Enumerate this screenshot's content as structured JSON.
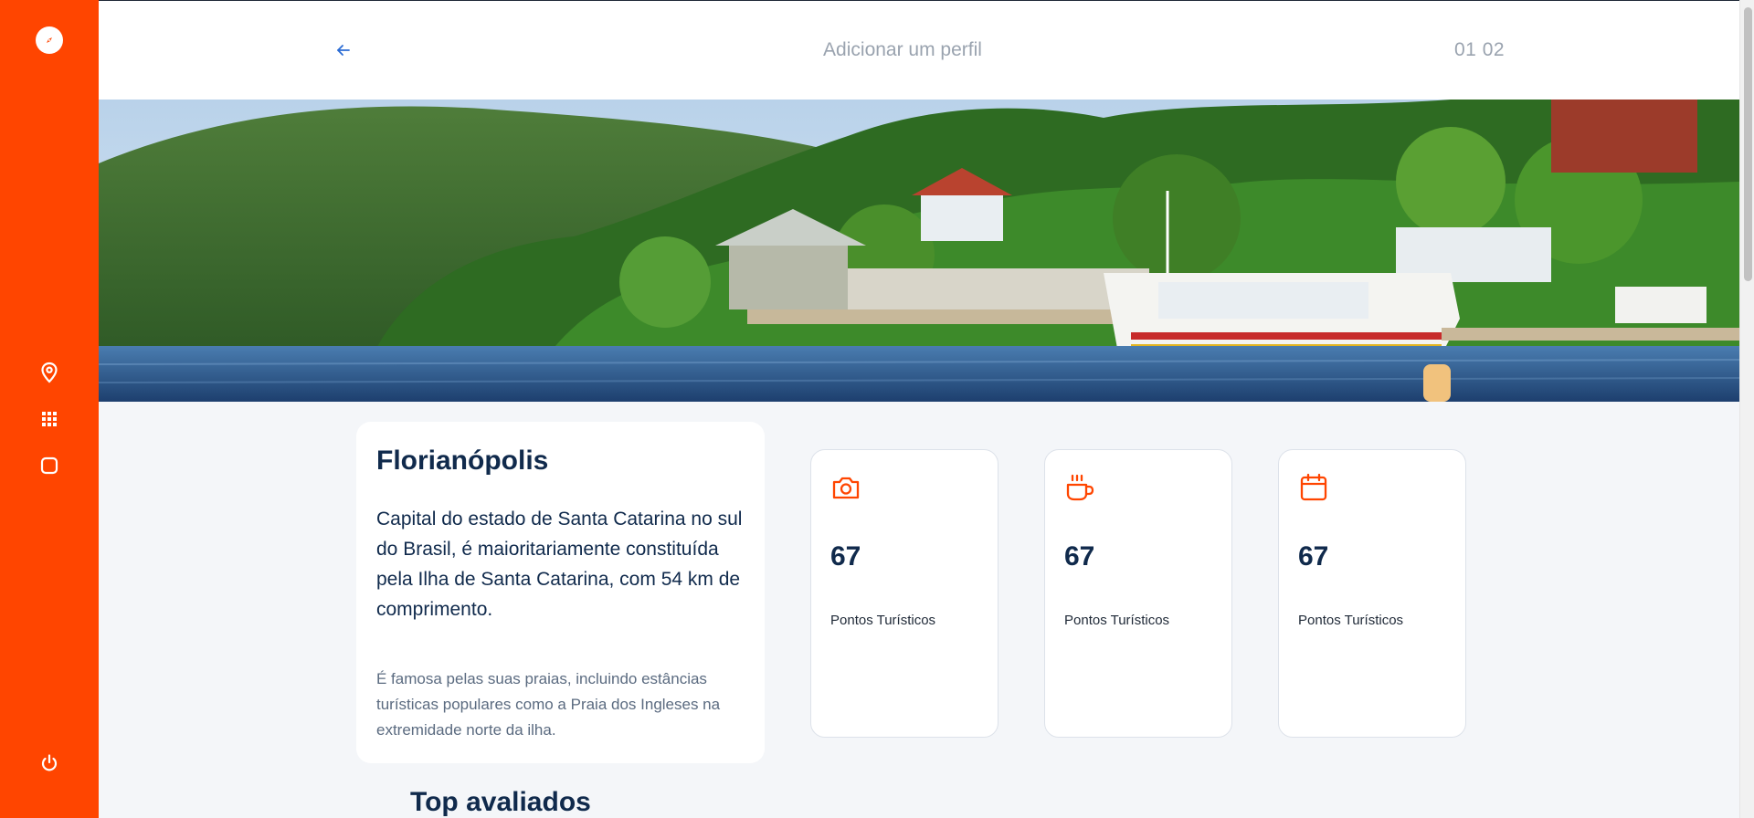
{
  "header": {
    "title": "Adicionar um perfil",
    "pagination": "01 02"
  },
  "sidebar": {
    "items": [
      {
        "icon": "map-pin-icon"
      },
      {
        "icon": "grid-icon"
      },
      {
        "icon": "square-icon"
      }
    ],
    "logout_icon": "power-icon",
    "logo_icon": "compass-icon"
  },
  "city": {
    "name": "Florianópolis",
    "description": "Capital do estado de Santa Catarina no sul do Brasil, é maioritariamente constituída pela Ilha de Santa Catarina, com 54 km de comprimento.",
    "extra": "É famosa pelas suas praias, incluindo estâncias turísticas populares como a Praia dos Ingleses na extremidade norte da ilha."
  },
  "stats": [
    {
      "icon": "camera-icon",
      "value": "67",
      "label": "Pontos Turísticos"
    },
    {
      "icon": "coffee-icon",
      "value": "67",
      "label": "Pontos Turísticos"
    },
    {
      "icon": "calendar-icon",
      "value": "67",
      "label": "Pontos Turísticos"
    }
  ],
  "sections": {
    "top_rated": "Top avaliados"
  },
  "colors": {
    "accent": "#ff4500",
    "heading": "#102a4c",
    "muted": "#9aa3af",
    "link": "#2b6cd4"
  }
}
